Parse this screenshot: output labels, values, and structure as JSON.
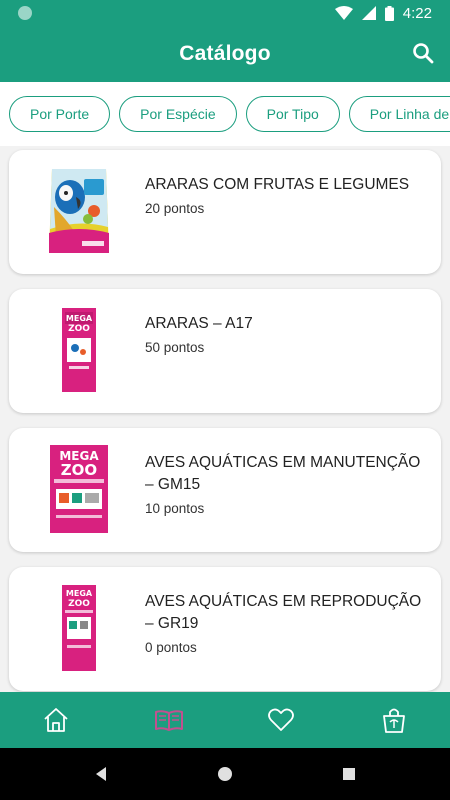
{
  "status_bar": {
    "time": "4:22"
  },
  "header": {
    "title": "Catálogo"
  },
  "filters": [
    "Por Porte",
    "Por Espécie",
    "Por Tipo",
    "Por Linha de"
  ],
  "products": [
    {
      "name": "ARARAS COM FRUTAS E LEGUMES",
      "points": "20 pontos",
      "package_label": "ARARAS"
    },
    {
      "name": "ARARAS – A17",
      "points": "50 pontos",
      "package_label": "MEGA ZOO"
    },
    {
      "name": "AVES AQUÁTICAS EM MANUTENÇÃO – GM15",
      "points": "10 pontos",
      "package_label": "MEGA ZOO"
    },
    {
      "name": "AVES AQUÁTICAS EM REPRODUÇÃO – GR19",
      "points": "0 pontos",
      "package_label": "MEGA ZOO"
    }
  ],
  "bottom_nav": [
    "home",
    "catalog",
    "favorites",
    "rewards"
  ],
  "colors": {
    "primary": "#1b9e7f",
    "active_tab": "#c2508f",
    "package_pink": "#d8217f"
  }
}
